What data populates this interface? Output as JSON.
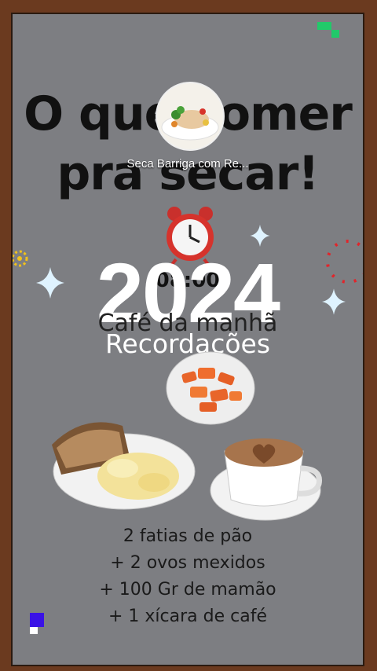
{
  "video": {
    "title_line1": "O que comer",
    "title_line2": "pra secar!",
    "channel_name": "Seca Barriga com Re...",
    "time": "08:00",
    "meal": "Café da manhã",
    "menu": [
      "2 fatias de pão",
      "+ 2 ovos mexidos",
      "+ 100 Gr de mamão",
      "+ 1 xícara de café"
    ]
  },
  "overlay": {
    "year": "2024",
    "label": "Recordações"
  },
  "colors": {
    "frame": "#6b3a1f",
    "background": "#7d7e82",
    "accent_white": "#ffffff"
  }
}
